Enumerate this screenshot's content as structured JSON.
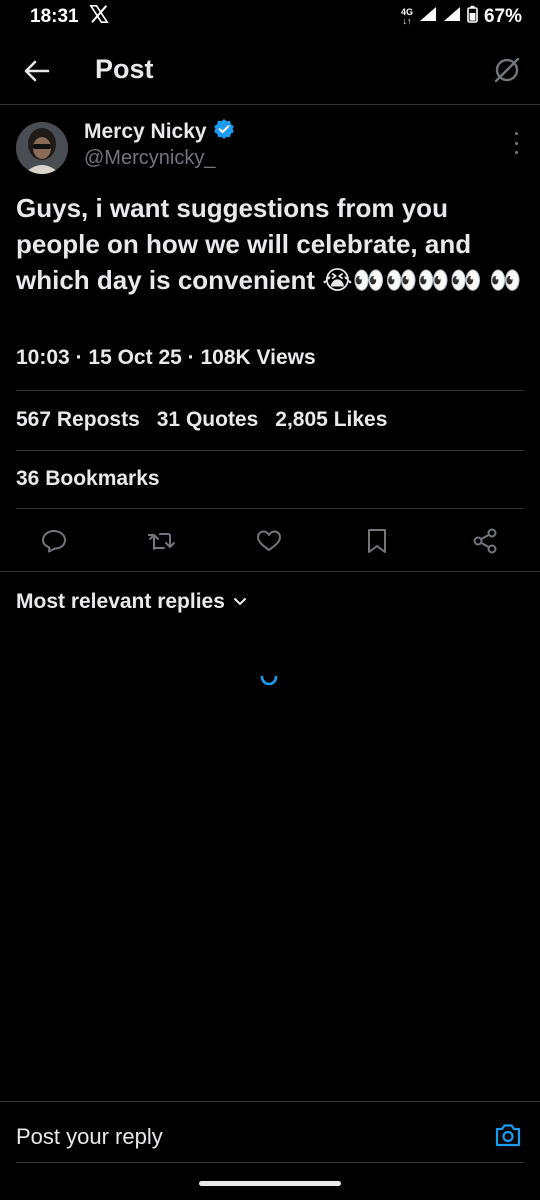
{
  "status_bar": {
    "time": "18:31",
    "app_icon": "x-logo-icon",
    "network": "4G",
    "battery": "67%"
  },
  "header": {
    "title": "Post",
    "back_icon": "arrow-left-icon",
    "grok_icon": "grok-icon"
  },
  "post": {
    "author_name": "Mercy Nicky",
    "author_handle": "@Mercynicky_",
    "verified": true,
    "text": "Guys, i want suggestions from you people on how we will celebrate, and which day is convenient 😭👀👀👀👀",
    "text_tail": "👀",
    "time": "10:03",
    "date": "15 Oct 25",
    "views": "108K Views",
    "separator": "·"
  },
  "stats": {
    "reposts_count": "567",
    "reposts_label": "Reposts",
    "quotes_count": "31",
    "quotes_label": "Quotes",
    "likes_count": "2,805",
    "likes_label": "Likes",
    "bookmarks_count": "36",
    "bookmarks_label": "Bookmarks"
  },
  "actions": [
    "reply-icon",
    "repost-icon",
    "like-icon",
    "bookmark-icon",
    "share-icon"
  ],
  "replies": {
    "sort_label": "Most relevant replies"
  },
  "composer": {
    "placeholder": "Post your reply"
  },
  "colors": {
    "background": "#000000",
    "text": "#e7e9ea",
    "secondary": "#71767b",
    "accent": "#1d9bf0",
    "divider": "#2f3336"
  }
}
